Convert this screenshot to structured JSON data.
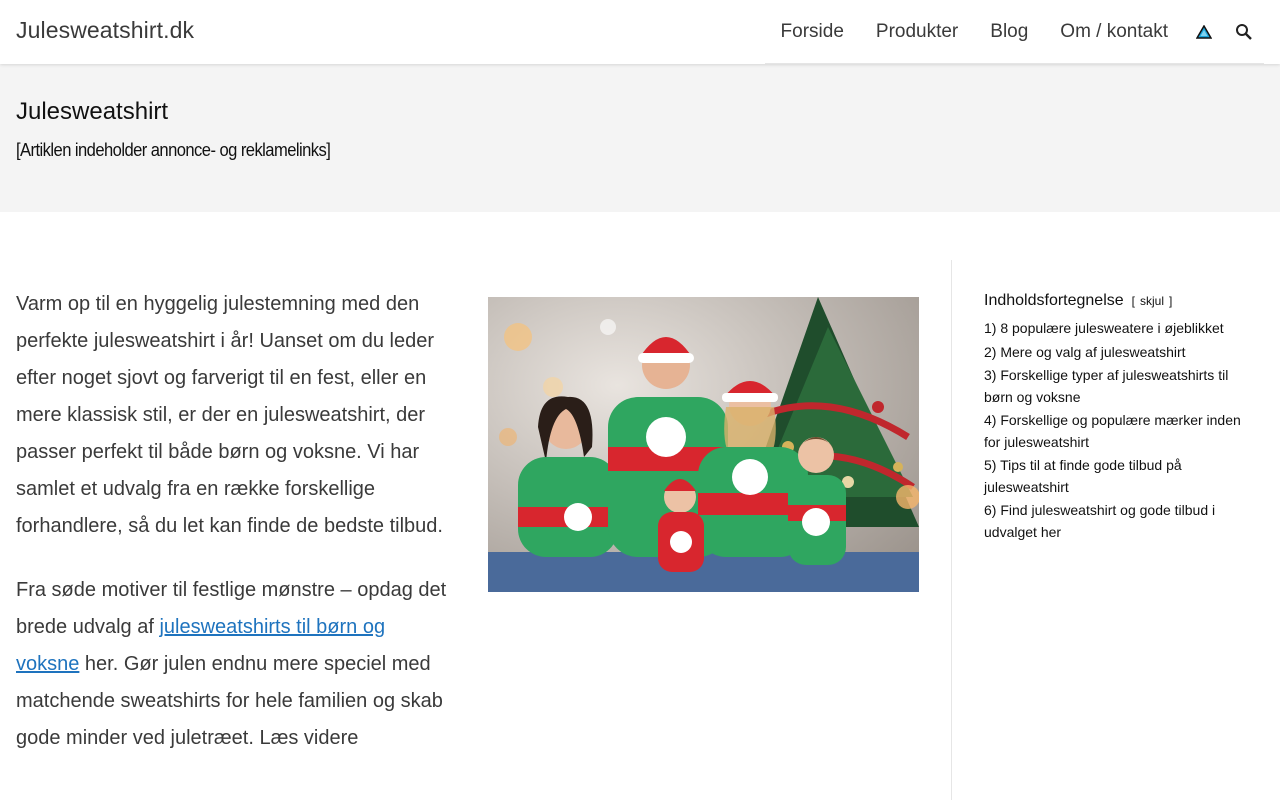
{
  "header": {
    "site_title": "Julesweatshirt.dk",
    "nav": [
      {
        "label": "Forside"
      },
      {
        "label": "Produkter"
      },
      {
        "label": "Blog"
      },
      {
        "label": "Om / kontakt"
      }
    ],
    "icons": [
      "triangle-logo-icon",
      "search-icon"
    ]
  },
  "page": {
    "title": "Julesweatshirt",
    "disclaimer": "[Artiklen indeholder annonce- og reklamelinks]"
  },
  "content": {
    "p1": "Varm op til en hyggelig julestemning med den perfekte julesweatshirt i år! Uanset om du leder efter noget sjovt og farverigt til en fest, eller en mere klassisk stil, er der en julesweatshirt, der passer perfekt til både børn og voksne. Vi har samlet et udvalg fra en række forskellige forhandlere, så du let kan finde de bedste tilbud.",
    "p2_before": "Fra søde motiver til festlige mønstre – opdag det brede udvalg af ",
    "p2_link": "julesweatshirts til børn og voksne",
    "p2_after": " her. Gør julen endnu mere speciel med matchende sweatshirts for hele familien og skab gode minder ved juletræet. Læs videre"
  },
  "toc": {
    "title": "Indholdsfortegnelse",
    "toggle_open": "[",
    "toggle_label": "skjul",
    "toggle_close": "]",
    "items": [
      "1) 8 populære julesweatere i øjeblikket",
      "2) Mere og valg af julesweatshirt",
      "3) Forskellige typer af julesweatshirts til børn og voksne",
      "4) Forskellige og populære mærker inden for julesweatshirt",
      "5) Tips til at finde gode tilbud på julesweatshirt",
      "6) Find julesweatshirt og gode tilbud i udvalget her"
    ]
  },
  "colors": {
    "link": "#1e73be",
    "text": "#3a3a3a",
    "band": "#f4f4f4",
    "logo_icon": "#1aa3d9"
  }
}
